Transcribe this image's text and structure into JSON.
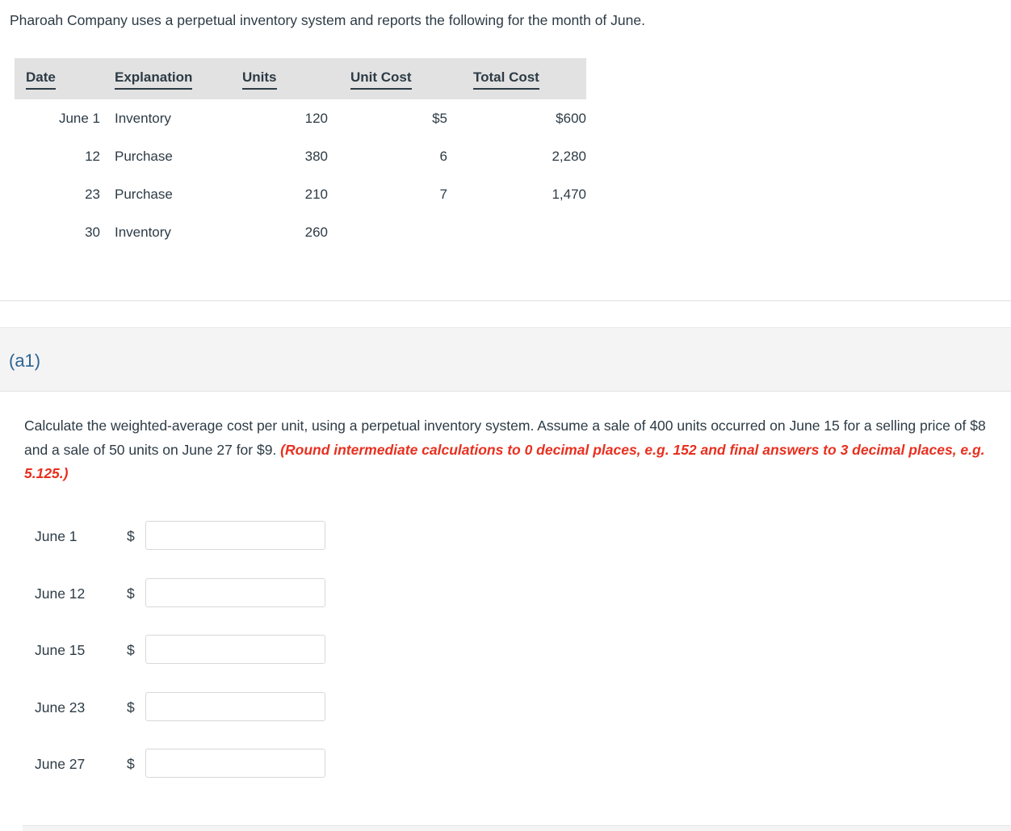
{
  "intro": {
    "text": "Pharoah Company uses a perpetual inventory system and reports the following for the month of June."
  },
  "inventory_table": {
    "columns": [
      "Date",
      "Explanation",
      "Units",
      "Unit Cost",
      "Total Cost"
    ],
    "rows": [
      {
        "date": "June 1",
        "explanation": "Inventory",
        "units": "120",
        "unit_cost": "$5",
        "total_cost": "$600"
      },
      {
        "date": "12",
        "explanation": "Purchase",
        "units": "380",
        "unit_cost": "6",
        "total_cost": "2,280"
      },
      {
        "date": "23",
        "explanation": "Purchase",
        "units": "210",
        "unit_cost": "7",
        "total_cost": "1,470"
      },
      {
        "date": "30",
        "explanation": "Inventory",
        "units": "260",
        "unit_cost": "",
        "total_cost": ""
      }
    ]
  },
  "part": {
    "label": "(a1)",
    "question_main": "Calculate the weighted-average cost per unit, using a perpetual inventory system. Assume a sale of 400 units occurred on June 15 for a selling price of $8 and a sale of 50 units on June 27 for $9. ",
    "question_hint": "(Round intermediate calculations to 0 decimal places, e.g. 152 and final answers to 3 decimal places, e.g. 5.125.)"
  },
  "answers": {
    "currency_symbol": "$",
    "rows": [
      {
        "label": "June 1",
        "value": "",
        "placeholder": ""
      },
      {
        "label": "June 12",
        "value": "",
        "placeholder": ""
      },
      {
        "label": "June 15",
        "value": "",
        "placeholder": ""
      },
      {
        "label": "June 23",
        "value": "",
        "placeholder": ""
      },
      {
        "label": "June 27",
        "value": "",
        "placeholder": ""
      }
    ]
  },
  "colors": {
    "text": "#2d3b45",
    "accent_blue": "#2a6496",
    "hint_red": "#e8301f",
    "header_band": "#e2e2e2",
    "panel_gray": "#f4f4f4"
  }
}
